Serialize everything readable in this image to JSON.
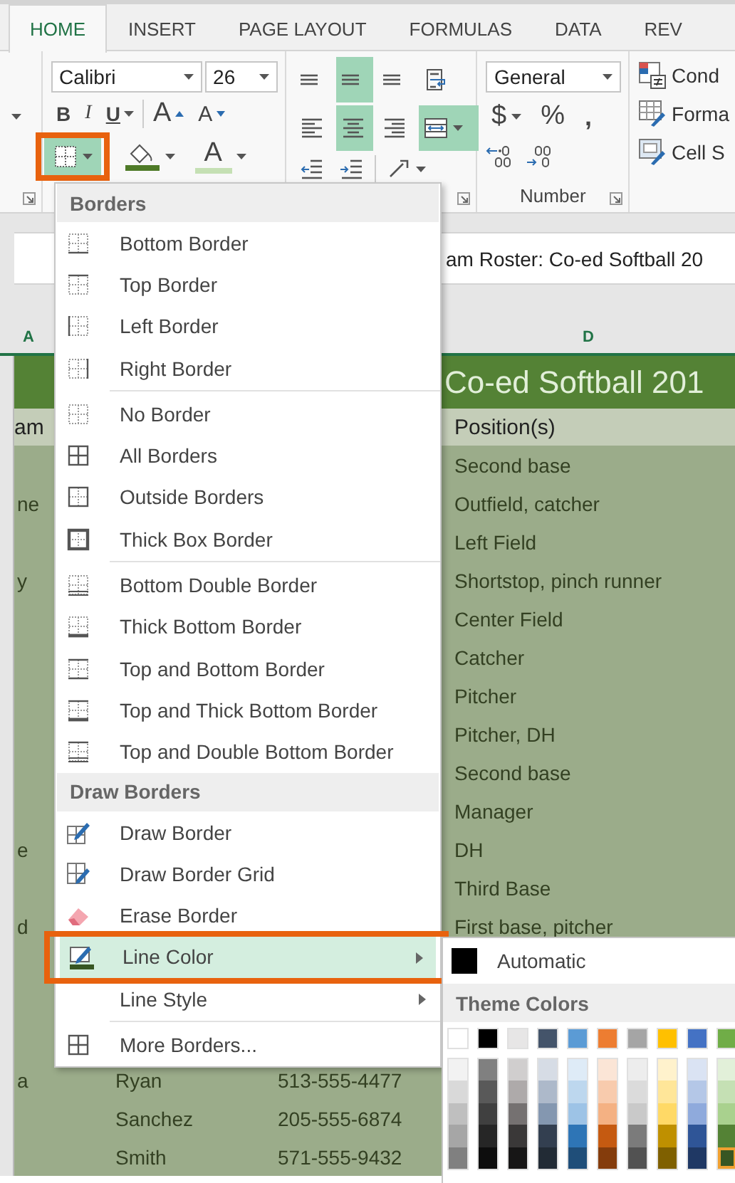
{
  "ribbon_tabs": [
    {
      "label": "HOME",
      "selected": true
    },
    {
      "label": "INSERT",
      "selected": false
    },
    {
      "label": "PAGE LAYOUT",
      "selected": false
    },
    {
      "label": "FORMULAS",
      "selected": false
    },
    {
      "label": "DATA",
      "selected": false
    },
    {
      "label": "REV",
      "selected": false
    }
  ],
  "font_group": {
    "font_name": "Calibri",
    "font_size": "26",
    "style_buttons": [
      {
        "kind": "bold",
        "label": "B"
      },
      {
        "kind": "italic",
        "label": "I"
      },
      {
        "kind": "underline",
        "label": "U"
      }
    ],
    "size_buttons": [
      {
        "kind": "grow",
        "label": "A"
      },
      {
        "kind": "shrink",
        "label": "A"
      }
    ],
    "borders_button": {
      "active": true,
      "callout": true
    },
    "fill_color": {
      "color": "#4e7a27"
    },
    "font_color": {
      "label": "A",
      "color": "#c5e0b4"
    }
  },
  "alignment_group": {
    "buttons": [
      {
        "kind": "top-align",
        "active": false
      },
      {
        "kind": "middle-align",
        "active": true
      },
      {
        "kind": "bottom-align",
        "active": false
      },
      {
        "kind": "wrap-text",
        "active": false
      },
      {
        "kind": "align-left",
        "active": false
      },
      {
        "kind": "align-center",
        "active": true
      },
      {
        "kind": "align-right",
        "active": false
      },
      {
        "kind": "merge-center",
        "active": true
      },
      {
        "kind": "decrease-indent",
        "active": false
      },
      {
        "kind": "increase-indent",
        "active": false
      },
      {
        "kind": "orientation",
        "active": false
      }
    ]
  },
  "number_group": {
    "format": "General",
    "buttons": [
      {
        "kind": "currency",
        "label": "$"
      },
      {
        "kind": "percent",
        "label": "%"
      },
      {
        "kind": "comma",
        "label": ","
      }
    ],
    "label": "Number"
  },
  "styles_group": {
    "items": [
      {
        "kind": "conditional-formatting",
        "label": "Cond"
      },
      {
        "kind": "format-table",
        "label": "Forma"
      },
      {
        "kind": "cell-styles",
        "label": "Cell S"
      }
    ]
  },
  "formula_bar": {
    "value": "am Roster: Co-ed Softball 20"
  },
  "sheet": {
    "column_headers": [
      "A",
      "D"
    ],
    "title": "Co-ed Softball 201",
    "header": {
      "column_a": "am",
      "column_d": "Position(s)"
    },
    "rows": [
      {
        "column_d": "Second base"
      },
      {
        "column_a": "ne",
        "column_d": "Outfield, catcher"
      },
      {
        "column_d": "Left Field"
      },
      {
        "column_a": "y",
        "column_d": "Shortstop, pinch runner"
      },
      {
        "column_d": "Center Field"
      },
      {
        "column_d": "Catcher"
      },
      {
        "column_d": "Pitcher"
      },
      {
        "column_d": "Pitcher, DH"
      },
      {
        "column_d": "Second base"
      },
      {
        "column_d": "Manager"
      },
      {
        "column_a": "e",
        "column_d": "DH"
      },
      {
        "column_d": "Third Base"
      },
      {
        "column_a": "d",
        "column_d": "First base, pitcher"
      }
    ],
    "lower_rows": [
      {
        "column_a": "a",
        "column_b": "Ryan",
        "column_c": "513-555-4477"
      },
      {
        "column_b": "Sanchez",
        "column_c": "205-555-6874"
      },
      {
        "column_b": "Smith",
        "column_c": "571-555-9432"
      }
    ]
  },
  "borders_menu": {
    "items": [
      {
        "kind": "header",
        "label": "Borders"
      },
      {
        "kind": "bottom-border",
        "label": "Bottom Border",
        "selected": false
      },
      {
        "kind": "top-border",
        "label": "Top Border",
        "selected": false
      },
      {
        "kind": "left-border",
        "label": "Left Border",
        "selected": false
      },
      {
        "kind": "right-border",
        "label": "Right Border",
        "selected": false
      },
      {
        "kind": "separator"
      },
      {
        "kind": "no-border",
        "label": "No Border",
        "selected": false
      },
      {
        "kind": "all-borders",
        "label": "All Borders",
        "selected": false
      },
      {
        "kind": "outside-borders",
        "label": "Outside Borders",
        "selected": false
      },
      {
        "kind": "thick-box-border",
        "label": "Thick Box Border",
        "selected": false
      },
      {
        "kind": "separator"
      },
      {
        "kind": "bottom-double-border",
        "label": "Bottom Double Border",
        "selected": false
      },
      {
        "kind": "thick-bottom-border",
        "label": "Thick Bottom Border",
        "selected": false
      },
      {
        "kind": "top-bottom-border",
        "label": "Top and Bottom Border",
        "selected": false
      },
      {
        "kind": "top-thick-bottom-border",
        "label": "Top and Thick Bottom Border",
        "selected": false
      },
      {
        "kind": "top-double-bottom-border",
        "label": "Top and Double Bottom Border",
        "selected": false
      },
      {
        "kind": "header",
        "label": "Draw Borders"
      },
      {
        "kind": "draw-border",
        "label": "Draw Border",
        "selected": false
      },
      {
        "kind": "draw-border-grid",
        "label": "Draw Border Grid",
        "selected": false
      },
      {
        "kind": "erase-border",
        "label": "Erase Border",
        "selected": false
      },
      {
        "kind": "line-color",
        "label": "Line Color",
        "selected": true,
        "callout": true
      },
      {
        "kind": "line-style",
        "label": "Line Style",
        "selected": false,
        "callout": false
      },
      {
        "kind": "separator"
      },
      {
        "kind": "more-borders",
        "label": "More Borders...",
        "selected": false
      }
    ]
  },
  "color_picker": {
    "automatic": {
      "label": "Automatic",
      "color": "#000000"
    },
    "theme_label": "Theme Colors",
    "theme_columns": [
      {
        "color": "#ffffff",
        "selected": false,
        "shades": [
          {
            "color": "#f2f2f2",
            "selected": false
          },
          {
            "color": "#d9d9d9",
            "selected": false
          },
          {
            "color": "#bfbfbf",
            "selected": false
          },
          {
            "color": "#a6a6a6",
            "selected": false
          },
          {
            "color": "#808080",
            "selected": false
          }
        ]
      },
      {
        "color": "#000000",
        "selected": false,
        "shades": [
          {
            "color": "#808080",
            "selected": false
          },
          {
            "color": "#595959",
            "selected": false
          },
          {
            "color": "#404040",
            "selected": false
          },
          {
            "color": "#262626",
            "selected": false
          },
          {
            "color": "#0d0d0d",
            "selected": false
          }
        ]
      },
      {
        "color": "#e7e6e6",
        "selected": false,
        "shades": [
          {
            "color": "#d0cece",
            "selected": false
          },
          {
            "color": "#aeaaaa",
            "selected": false
          },
          {
            "color": "#757171",
            "selected": false
          },
          {
            "color": "#3a3838",
            "selected": false
          },
          {
            "color": "#171616",
            "selected": false
          }
        ]
      },
      {
        "color": "#44546a",
        "selected": false,
        "shades": [
          {
            "color": "#d6dce5",
            "selected": false
          },
          {
            "color": "#adb9ca",
            "selected": false
          },
          {
            "color": "#8497b0",
            "selected": false
          },
          {
            "color": "#333f50",
            "selected": false
          },
          {
            "color": "#222b35",
            "selected": false
          }
        ]
      },
      {
        "color": "#5b9bd5",
        "selected": false,
        "shades": [
          {
            "color": "#deebf7",
            "selected": false
          },
          {
            "color": "#bdd7ee",
            "selected": false
          },
          {
            "color": "#9dc3e6",
            "selected": false
          },
          {
            "color": "#2e75b6",
            "selected": false
          },
          {
            "color": "#1f4e79",
            "selected": false
          }
        ]
      },
      {
        "color": "#ed7d31",
        "selected": false,
        "shades": [
          {
            "color": "#fbe5d6",
            "selected": false
          },
          {
            "color": "#f8cbad",
            "selected": false
          },
          {
            "color": "#f4b183",
            "selected": false
          },
          {
            "color": "#c55a11",
            "selected": false
          },
          {
            "color": "#843c0c",
            "selected": false
          }
        ]
      },
      {
        "color": "#a5a5a5",
        "selected": false,
        "shades": [
          {
            "color": "#ededed",
            "selected": false
          },
          {
            "color": "#dbdbdb",
            "selected": false
          },
          {
            "color": "#c9c9c9",
            "selected": false
          },
          {
            "color": "#7b7b7b",
            "selected": false
          },
          {
            "color": "#525252",
            "selected": false
          }
        ]
      },
      {
        "color": "#ffc000",
        "selected": false,
        "shades": [
          {
            "color": "#fff2cc",
            "selected": false
          },
          {
            "color": "#ffe699",
            "selected": false
          },
          {
            "color": "#ffd966",
            "selected": false
          },
          {
            "color": "#bf9000",
            "selected": false
          },
          {
            "color": "#7f6000",
            "selected": false
          }
        ]
      },
      {
        "color": "#4472c4",
        "selected": false,
        "shades": [
          {
            "color": "#dae3f3",
            "selected": false
          },
          {
            "color": "#b4c7e7",
            "selected": false
          },
          {
            "color": "#8faadc",
            "selected": false
          },
          {
            "color": "#2f5597",
            "selected": false
          },
          {
            "color": "#1f3864",
            "selected": false
          }
        ]
      },
      {
        "color": "#70ad47",
        "selected": false,
        "shades": [
          {
            "color": "#e2f0d9",
            "selected": false
          },
          {
            "color": "#c5e0b4",
            "selected": false
          },
          {
            "color": "#a9d18e",
            "selected": false
          },
          {
            "color": "#548235",
            "selected": false
          },
          {
            "color": "#375623",
            "selected": true
          }
        ]
      }
    ]
  }
}
